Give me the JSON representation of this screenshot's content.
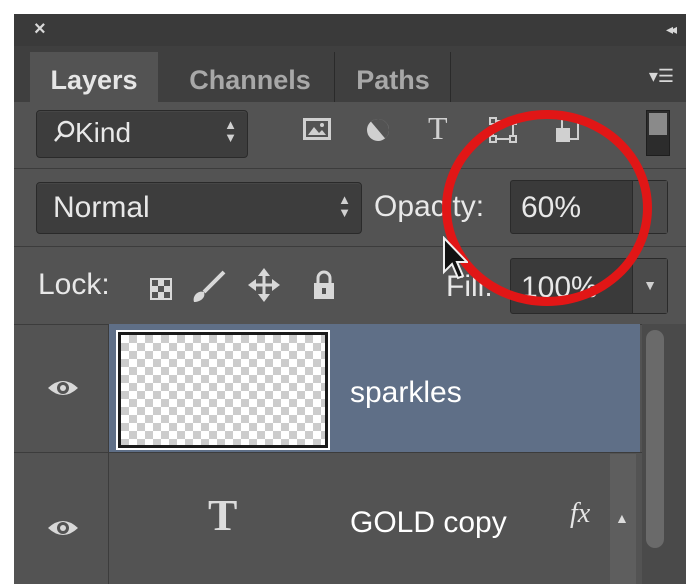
{
  "titlebar": {
    "close_glyph": "×",
    "collapse_glyph": "◂◂"
  },
  "tabs": [
    {
      "label": "Layers",
      "active": true
    },
    {
      "label": "Channels",
      "active": false
    },
    {
      "label": "Paths",
      "active": false
    }
  ],
  "panel_menu_icon": "panel-menu-icon",
  "filter": {
    "kind_label": "Kind",
    "icons": [
      "image-filter-icon",
      "adjustment-filter-icon",
      "type-filter-icon",
      "shape-filter-icon",
      "smart-object-filter-icon"
    ]
  },
  "blend": {
    "mode": "Normal"
  },
  "opacity": {
    "label": "Opacity:",
    "value": "60%"
  },
  "lock": {
    "label": "Lock:",
    "icons": [
      "lock-transparent-icon",
      "lock-image-icon",
      "lock-position-icon",
      "lock-all-icon"
    ]
  },
  "fill": {
    "label": "Fill:",
    "value": "100%"
  },
  "layers": [
    {
      "name": "sparkles",
      "type": "pixel",
      "selected": true,
      "visible": true
    },
    {
      "name": "GOLD copy",
      "type": "text",
      "selected": false,
      "visible": true,
      "fx": "fx"
    }
  ],
  "type_thumb_glyph": "T",
  "highlight_color": "#e11616",
  "selection_color": "#5f6f87"
}
